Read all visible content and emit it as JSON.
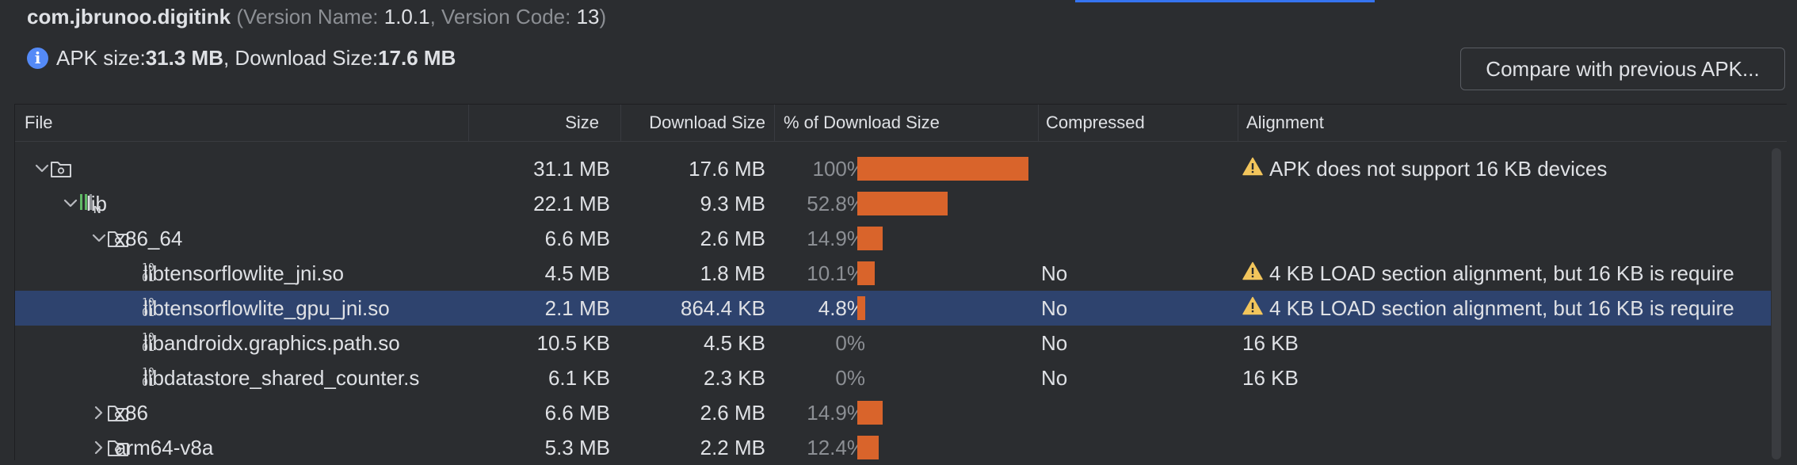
{
  "header": {
    "package": "com.jbrunoo.digitink",
    "version_name_label": " (Version Name: ",
    "version_name": "1.0.1",
    "version_code_label": ", Version Code: ",
    "version_code": "13",
    "close_paren": ")",
    "apk_size_label": "APK size: ",
    "apk_size": "31.3 MB",
    "download_size_label": ", Download Size: ",
    "download_size": "17.6 MB",
    "compare_button": "Compare with previous APK..."
  },
  "columns": [
    "File",
    "Size",
    "Download Size",
    "% of Download Size",
    "Compressed",
    "Alignment"
  ],
  "rows": [
    {
      "name": "",
      "size": "31.1 MB",
      "download": "17.6 MB",
      "pct": "100%",
      "pct_value": 100,
      "compressed": "",
      "alignment": "APK does not support 16 KB devices",
      "warning": true,
      "icon": "folder-icon",
      "level": 0,
      "expanded": true
    },
    {
      "name": "lib",
      "size": "22.1 MB",
      "download": "9.3 MB",
      "pct": "52.8%",
      "pct_value": 52.8,
      "compressed": "",
      "alignment": "",
      "warning": false,
      "icon": "native-lib-icon",
      "level": 1,
      "expanded": true
    },
    {
      "name": "x86_64",
      "size": "6.6 MB",
      "download": "2.6 MB",
      "pct": "14.9%",
      "pct_value": 14.9,
      "compressed": "",
      "alignment": "",
      "warning": false,
      "icon": "folder-icon",
      "level": 2,
      "expanded": true
    },
    {
      "name": "libtensorflowlite_jni.so",
      "size": "4.5 MB",
      "download": "1.8 MB",
      "pct": "10.1%",
      "pct_value": 10.1,
      "compressed": "No",
      "alignment": "4 KB LOAD section alignment, but 16 KB is require",
      "warning": true,
      "icon": "binary-file-icon",
      "level": 3
    },
    {
      "name": "libtensorflowlite_gpu_jni.so",
      "size": "2.1 MB",
      "download": "864.4 KB",
      "pct": "4.8%",
      "pct_value": 4.8,
      "compressed": "No",
      "alignment": "4 KB LOAD section alignment, but 16 KB is require",
      "warning": true,
      "icon": "binary-file-icon",
      "level": 3,
      "selected": true
    },
    {
      "name": "libandroidx.graphics.path.so",
      "size": "10.5 KB",
      "download": "4.5 KB",
      "pct": "0%",
      "pct_value": 0,
      "compressed": "No",
      "alignment": "16 KB",
      "warning": false,
      "icon": "binary-file-icon",
      "level": 3
    },
    {
      "name": "libdatastore_shared_counter.s",
      "size": "6.1 KB",
      "download": "2.3 KB",
      "pct": "0%",
      "pct_value": 0,
      "compressed": "No",
      "alignment": "16 KB",
      "warning": false,
      "icon": "binary-file-icon",
      "level": 3
    },
    {
      "name": "x86",
      "size": "6.6 MB",
      "download": "2.6 MB",
      "pct": "14.9%",
      "pct_value": 14.9,
      "compressed": "",
      "alignment": "",
      "warning": false,
      "icon": "folder-icon",
      "level": 2,
      "expanded": false
    },
    {
      "name": "arm64-v8a",
      "size": "5.3 MB",
      "download": "2.2 MB",
      "pct": "12.4%",
      "pct_value": 12.4,
      "compressed": "",
      "alignment": "",
      "warning": false,
      "icon": "folder-icon",
      "level": 2,
      "expanded": false
    }
  ],
  "colors": {
    "bar": "#d9642b",
    "selection": "#2e436e",
    "warning": "#f2c55c",
    "info": "#548af7"
  }
}
